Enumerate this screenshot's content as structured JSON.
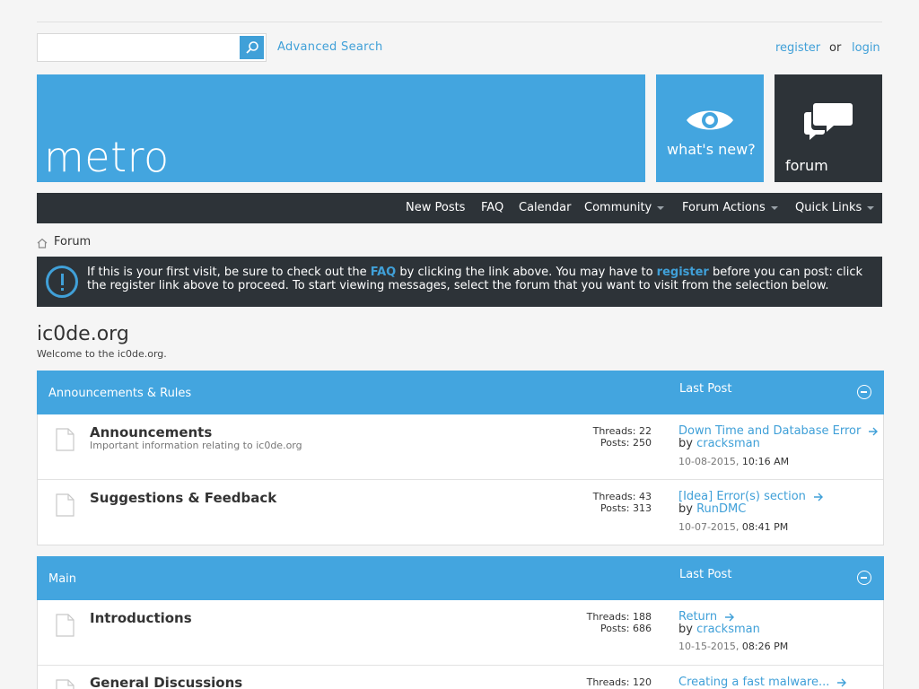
{
  "header": {
    "search_placeholder": "",
    "advanced_search": "Advanced Search",
    "register": "register",
    "or": "or",
    "login": "login"
  },
  "tiles": {
    "brand": "metro",
    "whats_new": "what's new?",
    "forum": "forum"
  },
  "nav": {
    "items": [
      "New Posts",
      "FAQ",
      "Calendar",
      "Community",
      "Forum Actions",
      "Quick Links"
    ]
  },
  "breadcrumb": {
    "current": "Forum"
  },
  "notice": {
    "part1": "If this is your first visit, be sure to check out the ",
    "faq": "FAQ",
    "part2": " by clicking the link above. You may have to ",
    "register": "register",
    "part3": " before you can post: click the register link above to proceed. To start viewing messages, select the forum that you want to visit from the selection below."
  },
  "site": {
    "title": "ic0de.org",
    "welcome": "Welcome to the ic0de.org."
  },
  "categories": [
    {
      "title": "Announcements & Rules",
      "last_post_label": "Last Post",
      "forums": [
        {
          "name": "Announcements",
          "desc": "Important information relating to ic0de.org",
          "threads": "Threads: 22",
          "posts": "Posts: 250",
          "lp_title": "Down Time and Database Error",
          "lp_by": "by ",
          "lp_user": "cracksman",
          "lp_date": "10-08-2015, ",
          "lp_time": "10:16 AM"
        },
        {
          "name": "Suggestions & Feedback",
          "desc": "",
          "threads": "Threads: 43",
          "posts": "Posts: 313",
          "lp_title": "[Idea] Error(s) section",
          "lp_by": "by ",
          "lp_user": "RunDMC",
          "lp_date": "10-07-2015, ",
          "lp_time": "08:41 PM"
        }
      ]
    },
    {
      "title": "Main",
      "last_post_label": "Last Post",
      "forums": [
        {
          "name": "Introductions",
          "desc": "",
          "threads": "Threads: 188",
          "posts": "Posts: 686",
          "lp_title": "Return",
          "lp_by": "by ",
          "lp_user": "cracksman",
          "lp_date": "10-15-2015, ",
          "lp_time": "08:26 PM"
        },
        {
          "name": "General Discussions",
          "desc": "",
          "threads": "Threads: 120",
          "posts": "",
          "lp_title": "Creating a fast malware...",
          "lp_by": "",
          "lp_user": "",
          "lp_date": "",
          "lp_time": ""
        }
      ]
    }
  ],
  "colors": {
    "accent": "#43a5df",
    "dark": "#2d3338",
    "link": "#40a0d8"
  }
}
